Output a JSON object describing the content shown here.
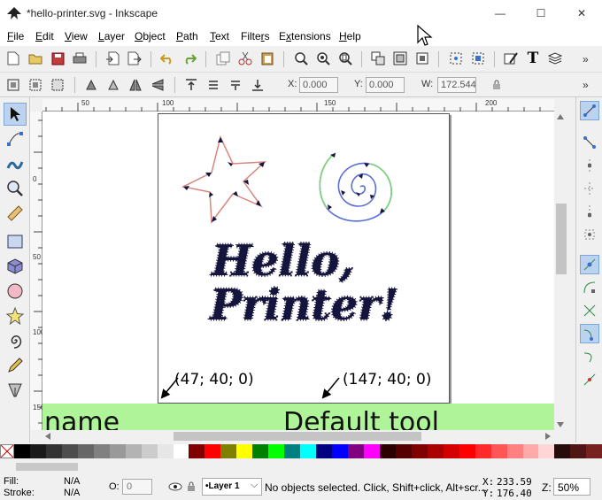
{
  "window": {
    "title": "*hello-printer.svg - Inkscape",
    "minimize_glyph": "—",
    "maximize_glyph": "☐",
    "close_glyph": "✕"
  },
  "menu": [
    {
      "label": "File",
      "ul": "F",
      "rest": "ile"
    },
    {
      "label": "Edit",
      "ul": "E",
      "rest": "dit"
    },
    {
      "label": "View",
      "ul": "V",
      "rest": "iew"
    },
    {
      "label": "Layer",
      "ul": "L",
      "rest": "ayer"
    },
    {
      "label": "Object",
      "ul": "O",
      "rest": "bject"
    },
    {
      "label": "Path",
      "ul": "P",
      "rest": "ath"
    },
    {
      "label": "Text",
      "ul": "T",
      "rest": "ext"
    },
    {
      "label": "Filters",
      "ul": "r",
      "pre": "Filte",
      "rest": "s"
    },
    {
      "label": "Extensions",
      "ul": "x",
      "pre": "E",
      "rest": "tensions"
    },
    {
      "label": "Help",
      "ul": "H",
      "rest": "elp"
    }
  ],
  "toolbar_more": "»",
  "toolbar2": {
    "x_label": "X:",
    "x_value": "0.000",
    "y_label": "Y:",
    "y_value": "0.000",
    "w_label": "W:",
    "w_value": "172.544"
  },
  "hruler_labels": [
    "50",
    "100",
    "150",
    "200"
  ],
  "vruler_labels": [
    "0",
    "50",
    "100",
    "150"
  ],
  "canvas": {
    "coord_left": "(47; 40; 0)",
    "coord_right": "(147; 40; 0)",
    "band_left": "name",
    "band_right": "Default tool"
  },
  "colors": {
    "star_stroke": "#d9857a",
    "spiral_blue": "#5a6fd6",
    "spiral_green": "#7fd67a",
    "text_fill": "#14143c",
    "band": "#b0f49a",
    "active_tool": "#bcd3ef"
  },
  "palette": [
    "#000000",
    "#1a1a1a",
    "#333333",
    "#4d4d4d",
    "#666666",
    "#808080",
    "#999999",
    "#b3b3b3",
    "#cccccc",
    "#e6e6e6",
    "#ffffff",
    "#800000",
    "#ff0000",
    "#808000",
    "#ffff00",
    "#008000",
    "#00ff00",
    "#008080",
    "#00ffff",
    "#000080",
    "#0000ff",
    "#800080",
    "#ff00ff",
    "#2b0000",
    "#550000",
    "#800000",
    "#aa0000",
    "#d40000",
    "#ff0000",
    "#ff2a2a",
    "#ff5555",
    "#ff8080",
    "#ffaaaa",
    "#ffd5d5",
    "#280b0b",
    "#501616",
    "#782121"
  ],
  "status": {
    "fill_label": "Fill:",
    "fill_value": "N/A",
    "stroke_label": "Stroke:",
    "stroke_value": "N/A",
    "opacity_label": "O:",
    "opacity_value": "0",
    "layer": "•Layer 1",
    "message": "No objects selected. Click, Shift+click, Alt+scr...",
    "x_label": "X:",
    "x_value": "233.59",
    "y_label": "Y:",
    "y_value": "176.40",
    "zoom_label": "Z:",
    "zoom_value": "50%"
  }
}
